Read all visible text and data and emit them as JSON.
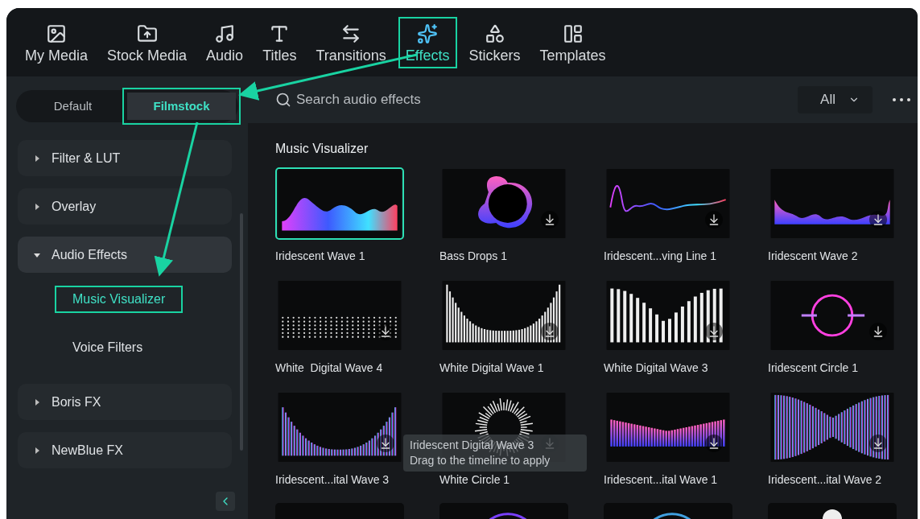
{
  "toolbar": {
    "tabs": [
      {
        "label": "My Media",
        "kind": "media",
        "selected": false,
        "highlighted": false
      },
      {
        "label": "Stock Media",
        "kind": "cloud",
        "selected": false,
        "highlighted": false
      },
      {
        "label": "Audio",
        "kind": "music",
        "selected": false,
        "highlighted": false
      },
      {
        "label": "Titles",
        "kind": "text",
        "selected": false,
        "highlighted": false
      },
      {
        "label": "Transitions",
        "kind": "transition",
        "selected": false,
        "highlighted": false
      },
      {
        "label": "Effects",
        "kind": "sparkle",
        "selected": true,
        "highlighted": true
      },
      {
        "label": "Stickers",
        "kind": "sticker",
        "selected": false,
        "highlighted": false
      },
      {
        "label": "Templates",
        "kind": "template",
        "selected": false,
        "highlighted": false
      }
    ]
  },
  "sidebar": {
    "segments": [
      {
        "label": "Default",
        "selected": false,
        "highlighted": false
      },
      {
        "label": "Filmstock",
        "selected": true,
        "highlighted": true
      }
    ],
    "items": [
      {
        "label": "Filter & LUT",
        "expanded": false
      },
      {
        "label": "Overlay",
        "expanded": false
      },
      {
        "label": "Audio Effects",
        "expanded": true,
        "children": [
          {
            "label": "Music Visualizer",
            "selected": true,
            "highlighted": true
          },
          {
            "label": "Voice Filters",
            "selected": false,
            "highlighted": false
          }
        ]
      },
      {
        "label": "Boris FX",
        "expanded": false
      },
      {
        "label": "NewBlue FX",
        "expanded": false
      }
    ]
  },
  "search": {
    "placeholder": "Search audio effects"
  },
  "filter": {
    "value": "All"
  },
  "section": {
    "title": "Music Visualizer",
    "cards": [
      {
        "name": "Iridescent Wave 1",
        "kind": "wave",
        "selected": true,
        "download": false
      },
      {
        "name": "Bass Drops 1",
        "kind": "ring",
        "selected": false,
        "download": true
      },
      {
        "name": "Iridescent...ving Line 1",
        "kind": "line",
        "selected": false,
        "download": true
      },
      {
        "name": "Iridescent Wave 2",
        "kind": "wave2",
        "selected": false,
        "download": true
      },
      {
        "name": "White  Digital Wave 4",
        "kind": "dots",
        "selected": false,
        "download": true
      },
      {
        "name": "White Digital Wave 1",
        "kind": "bars",
        "selected": false,
        "download": true
      },
      {
        "name": "White Digital Wave 3",
        "kind": "bars2",
        "selected": false,
        "download": true
      },
      {
        "name": "Iridescent Circle 1",
        "kind": "circle",
        "selected": false,
        "download": true
      },
      {
        "name": "Iridescent...ital Wave 3",
        "kind": "colorbars",
        "selected": false,
        "download": true
      },
      {
        "name": "White Circle 1",
        "kind": "spikes",
        "selected": false,
        "download": true
      },
      {
        "name": "Iridescent...ital Wave 1",
        "kind": "colorbars2",
        "selected": false,
        "download": true
      },
      {
        "name": "Iridescent...ital Wave 2",
        "kind": "colorbars3",
        "selected": false,
        "download": true
      }
    ],
    "more_cards": [
      {
        "kind": "dark"
      },
      {
        "kind": "arc"
      },
      {
        "kind": "arc2"
      },
      {
        "kind": "blob"
      }
    ]
  },
  "tooltip": {
    "title": "Iridescent Digital Wave 3",
    "hint": "Drag to the timeline to apply"
  }
}
